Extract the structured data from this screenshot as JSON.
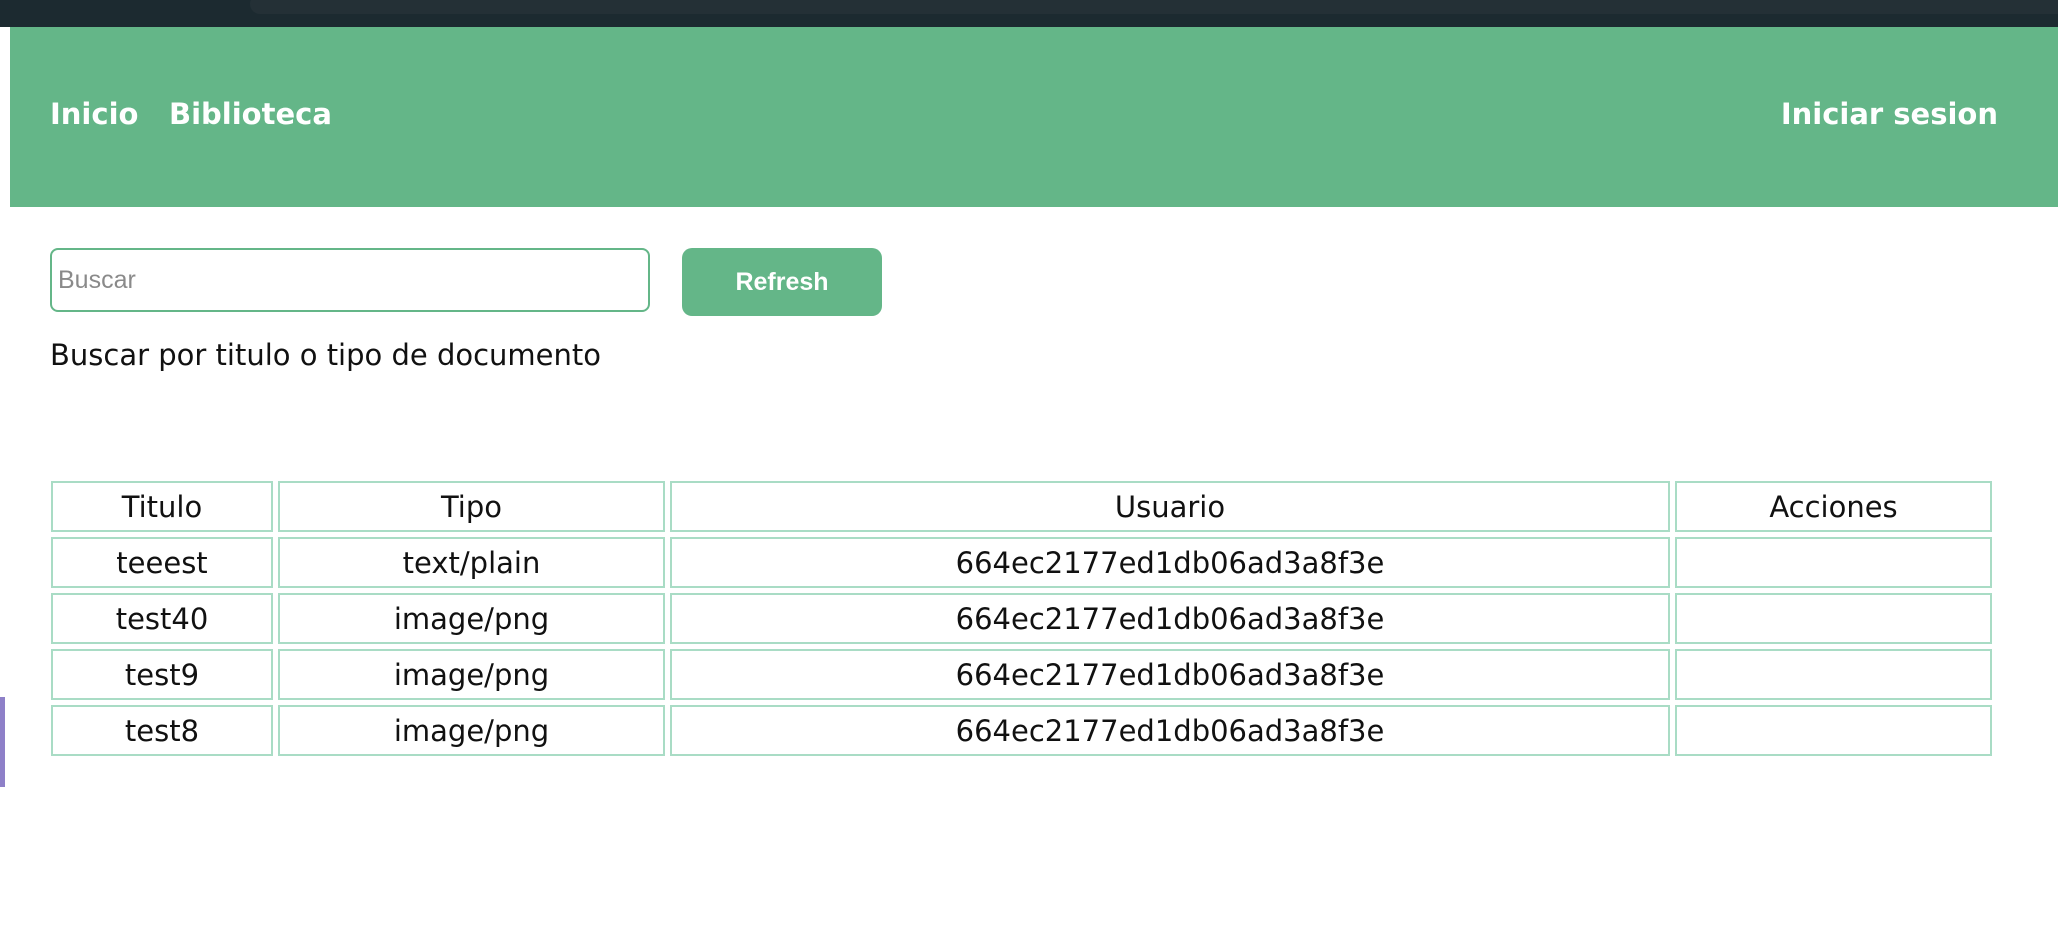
{
  "nav": {
    "home_label": "Inicio",
    "library_label": "Biblioteca",
    "login_label": "Iniciar sesion"
  },
  "search": {
    "placeholder": "Buscar",
    "value": "",
    "refresh_label": "Refresh",
    "helper_text": "Buscar por titulo o tipo de documento"
  },
  "table": {
    "headers": [
      "Titulo",
      "Tipo",
      "Usuario",
      "Acciones"
    ],
    "rows": [
      [
        "teeest",
        "text/plain",
        "664ec2177ed1db06ad3a8f3e",
        ""
      ],
      [
        "test40",
        "image/png",
        "664ec2177ed1db06ad3a8f3e",
        ""
      ],
      [
        "test9",
        "image/png",
        "664ec2177ed1db06ad3a8f3e",
        ""
      ],
      [
        "test8",
        "image/png",
        "664ec2177ed1db06ad3a8f3e",
        ""
      ]
    ]
  },
  "colors": {
    "accent": "#64b688",
    "table_border": "#a9dcc5",
    "top_strip": "#1c2a30"
  }
}
